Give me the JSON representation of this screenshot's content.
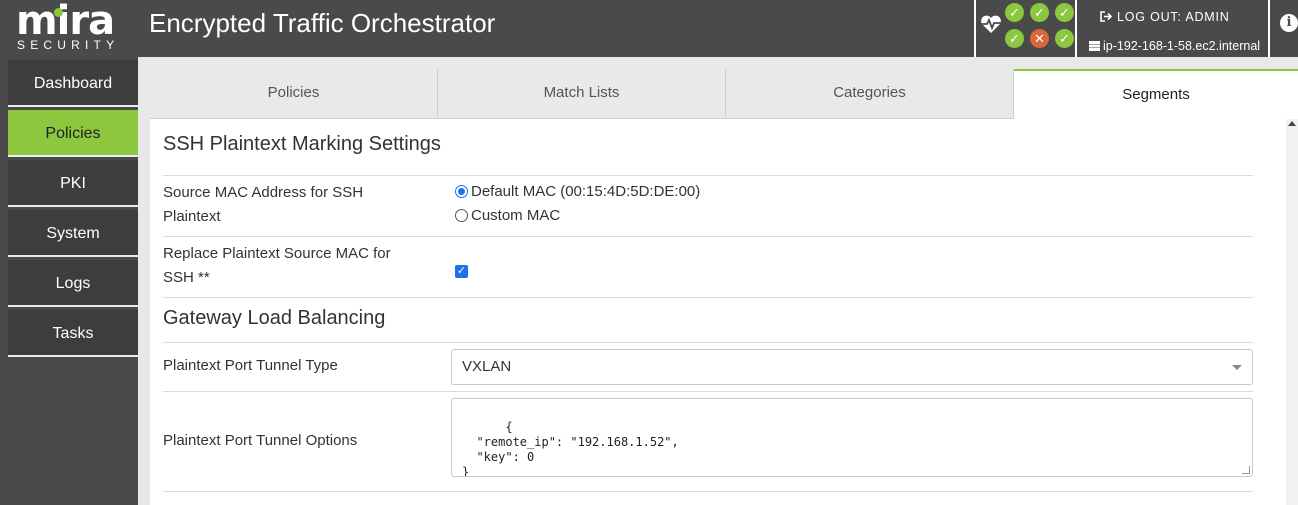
{
  "header": {
    "logo_word": "mira",
    "logo_sub": "SECURITY",
    "title": "Encrypted Traffic Orchestrator",
    "logout_label": "LOG OUT: ADMIN",
    "hostname": "ip-192-168-1-58.ec2.internal",
    "status_indicators": [
      "ok",
      "ok",
      "ok",
      "ok",
      "error",
      "ok"
    ]
  },
  "sidebar": {
    "items": [
      {
        "label": "Dashboard",
        "active": false
      },
      {
        "label": "Policies",
        "active": true
      },
      {
        "label": "PKI",
        "active": false
      },
      {
        "label": "System",
        "active": false
      },
      {
        "label": "Logs",
        "active": false
      },
      {
        "label": "Tasks",
        "active": false
      }
    ]
  },
  "tabs": [
    {
      "label": "Policies",
      "active": false
    },
    {
      "label": "Match Lists",
      "active": false
    },
    {
      "label": "Categories",
      "active": false
    },
    {
      "label": "Segments",
      "active": true
    }
  ],
  "ssh_section": {
    "title": "SSH Plaintext Marking Settings",
    "source_mac_label_line1": "Source MAC Address for SSH",
    "source_mac_label_line2": "Plaintext",
    "option_default": "Default MAC (00:15:4D:5D:DE:00)",
    "option_custom": "Custom MAC",
    "selected_option": "default",
    "replace_label_line1": "Replace Plaintext Source MAC for",
    "replace_label_line2": "SSH **",
    "replace_checked": true
  },
  "gateway_section": {
    "title": "Gateway Load Balancing",
    "tunnel_type_label": "Plaintext Port Tunnel Type",
    "tunnel_type_value": "VXLAN",
    "tunnel_options_label": "Plaintext Port Tunnel Options",
    "tunnel_options_value": "{\n  \"remote_ip\": \"192.168.1.52\",\n  \"key\": 0\n}"
  },
  "colors": {
    "accent": "#8dc63f",
    "header_bg": "#4a4a4a",
    "error": "#d9683a",
    "check_blue": "#1a73e8"
  }
}
